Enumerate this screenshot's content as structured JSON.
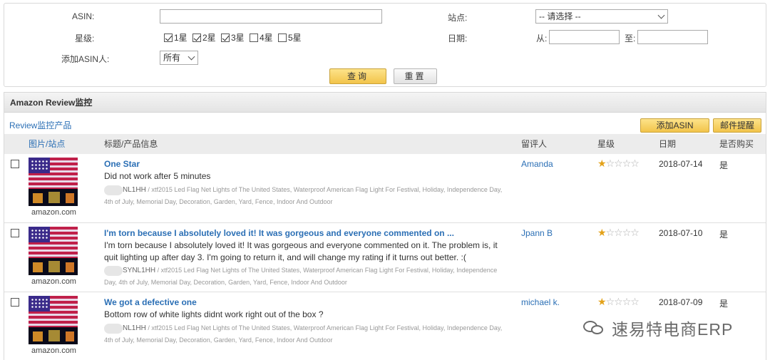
{
  "filters": {
    "asin_label": "ASIN:",
    "asin_value": "",
    "star_label": "星级:",
    "stars": [
      {
        "label": "1星",
        "checked": true
      },
      {
        "label": "2星",
        "checked": true
      },
      {
        "label": "3星",
        "checked": true
      },
      {
        "label": "4星",
        "checked": false
      },
      {
        "label": "5星",
        "checked": false
      }
    ],
    "adder_label": "添加ASIN人:",
    "adder_value": "所有",
    "site_label": "站点:",
    "site_value": "-- 请选择 --",
    "date_label": "日期:",
    "from_label": "从:",
    "to_label": "至:",
    "from_value": "",
    "to_value": "",
    "query_button": "查询",
    "reset_button": "重置"
  },
  "panel": {
    "title": "Amazon Review监控",
    "tab_link": "Review监控产品",
    "add_asin_button": "添加ASIN",
    "email_alert_button": "邮件提醒"
  },
  "table": {
    "columns": [
      "图片/站点",
      "标题/产品信息",
      "留评人",
      "星级",
      "日期",
      "是否购买"
    ],
    "rows": [
      {
        "site": "amazon.com",
        "title": "One Star",
        "body": "Did not work after 5 minutes",
        "asin_fragment": "NL1HH",
        "product": "/ xtf2015 Led Flag Net Lights of The United States, Waterproof American Flag Light For Festival, Holiday, Independence Day, 4th of July, Memorial Day, Decoration, Garden, Yard, Fence, Indoor And Outdoor",
        "reviewer": "Amanda",
        "rating": 1,
        "date": "2018-07-14",
        "purchased": "是"
      },
      {
        "site": "amazon.com",
        "title": "I'm torn because I absolutely loved it! It was gorgeous and everyone commented on ...",
        "body": "I'm torn because I absolutely loved it! It was gorgeous and everyone commented on it. The problem is, it quit lighting up after day 3. I'm going to return it, and will change my rating if it turns out better. :(",
        "asin_fragment": "SYNL1HH",
        "product": "/ xtf2015 Led Flag Net Lights of The United States, Waterproof American Flag Light For Festival, Holiday, Independence Day, 4th of July, Memorial Day, Decoration, Garden, Yard, Fence, Indoor And Outdoor",
        "reviewer": "Jpann B",
        "rating": 1,
        "date": "2018-07-10",
        "purchased": "是"
      },
      {
        "site": "amazon.com",
        "title": "We got a defective one",
        "body": "Bottom row of white lights didnt work right out of the box ?",
        "asin_fragment": "NL1HH",
        "product": "/ xtf2015 Led Flag Net Lights of The United States, Waterproof American Flag Light For Festival, Holiday, Independence Day, 4th of July, Memorial Day, Decoration, Garden, Yard, Fence, Indoor And Outdoor",
        "reviewer": "michael k.",
        "rating": 1,
        "date": "2018-07-09",
        "purchased": "是"
      }
    ]
  },
  "watermark": "速易特电商ERP",
  "colors": {
    "link": "#2b6fb5",
    "gold_button": "#f2c44a",
    "star_on": "#e3a21a",
    "star_off": "#b0b0b0"
  },
  "icons": {
    "rating_star": "star-icon",
    "product_image": "flag-lights-thumbnail",
    "watermark_logo": "wechat-icon"
  }
}
